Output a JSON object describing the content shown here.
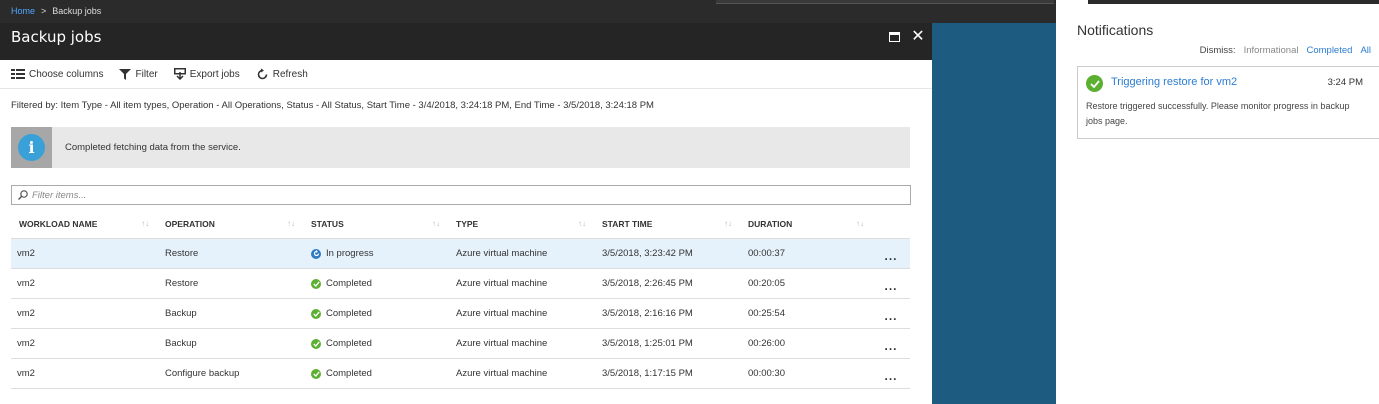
{
  "breadcrumb": {
    "home": "Home",
    "separator": ">",
    "current": "Backup jobs"
  },
  "blade": {
    "title": "Backup jobs"
  },
  "toolbar": {
    "choose_columns": "Choose columns",
    "filter": "Filter",
    "export_jobs": "Export jobs",
    "refresh": "Refresh"
  },
  "filter_summary": "Filtered by: Item Type - All item types, Operation - All Operations, Status - All Status, Start Time - 3/4/2018, 3:24:18 PM, End Time - 3/5/2018, 3:24:18 PM",
  "info_message": "Completed fetching data from the service.",
  "search": {
    "placeholder": "Filter items..."
  },
  "columns": [
    "WORKLOAD NAME",
    "OPERATION",
    "STATUS",
    "TYPE",
    "START TIME",
    "DURATION"
  ],
  "rows": [
    {
      "workload": "vm2",
      "operation": "Restore",
      "status": "In progress",
      "type": "Azure virtual machine",
      "start": "3/5/2018, 3:23:42 PM",
      "duration": "00:00:37"
    },
    {
      "workload": "vm2",
      "operation": "Restore",
      "status": "Completed",
      "type": "Azure virtual machine",
      "start": "3/5/2018, 2:26:45 PM",
      "duration": "00:20:05"
    },
    {
      "workload": "vm2",
      "operation": "Backup",
      "status": "Completed",
      "type": "Azure virtual machine",
      "start": "3/5/2018, 2:16:16 PM",
      "duration": "00:25:54"
    },
    {
      "workload": "vm2",
      "operation": "Backup",
      "status": "Completed",
      "type": "Azure virtual machine",
      "start": "3/5/2018, 1:25:01 PM",
      "duration": "00:26:00"
    },
    {
      "workload": "vm2",
      "operation": "Configure backup",
      "status": "Completed",
      "type": "Azure virtual machine",
      "start": "3/5/2018, 1:17:15 PM",
      "duration": "00:00:30"
    }
  ],
  "row_menu": "...",
  "notifications": {
    "title": "Notifications",
    "dismiss_label": "Dismiss:",
    "dismiss_informational": "Informational",
    "dismiss_completed": "Completed",
    "dismiss_all": "All",
    "items": [
      {
        "title": "Triggering restore for vm2",
        "time": "3:24 PM",
        "body": "Restore triggered successfully. Please monitor progress in backup jobs page."
      }
    ]
  },
  "colors": {
    "accent": "#2b7cd3",
    "success": "#5cb031",
    "in_progress": "#2e7bc0",
    "background_blue": "#1d5b80",
    "header_dark": "#252525"
  }
}
